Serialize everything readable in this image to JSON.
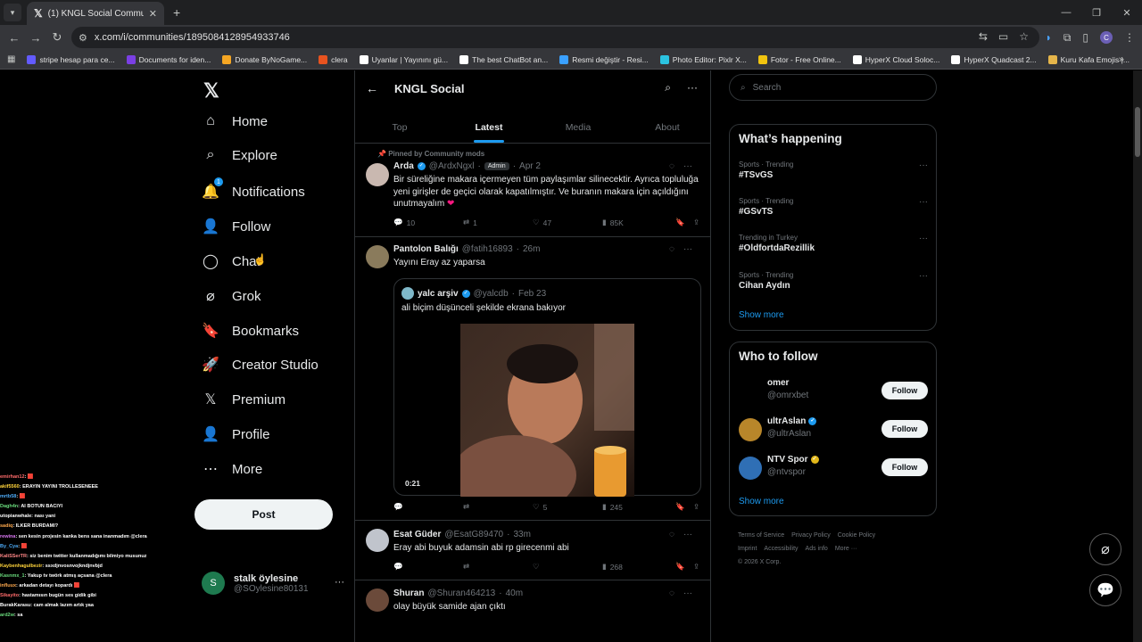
{
  "browser": {
    "tab_title": "(1) KNGL Social Community / X",
    "url": "x.com/i/communities/1895084128954933746",
    "bookmarks": [
      {
        "label": "stripe hesap para ce...",
        "color": "#635bff"
      },
      {
        "label": "Documents for iden...",
        "color": "#7b3fe4"
      },
      {
        "label": "Donate ByNoGame...",
        "color": "#f5a623"
      },
      {
        "label": "clera",
        "color": "#e8531f"
      },
      {
        "label": "Uyanlar | Yayınını gü...",
        "color": "#ffffff"
      },
      {
        "label": "The best ChatBot an...",
        "color": "#ffffff"
      },
      {
        "label": "Resmi değiştir - Resi...",
        "color": "#3aa0ff"
      },
      {
        "label": "Photo Editor: Pixlr X...",
        "color": "#2bc3e0"
      },
      {
        "label": "Fotor - Free Online...",
        "color": "#f1c40f"
      },
      {
        "label": "HyperX Cloud Soloc...",
        "color": "#ffffff"
      },
      {
        "label": "HyperX Quadcast 2...",
        "color": "#ffffff"
      },
      {
        "label": "Kuru Kafa Emojis |...",
        "color": "#e5b54a"
      }
    ]
  },
  "nav": {
    "items": [
      {
        "label": "Home",
        "icon": "home-icon"
      },
      {
        "label": "Explore",
        "icon": "search-icon"
      },
      {
        "label": "Notifications",
        "icon": "bell-icon",
        "badge": "1"
      },
      {
        "label": "Follow",
        "icon": "follow-icon"
      },
      {
        "label": "Chat",
        "icon": "chat-icon"
      },
      {
        "label": "Grok",
        "icon": "grok-icon"
      },
      {
        "label": "Bookmarks",
        "icon": "bookmark-icon"
      },
      {
        "label": "Creator Studio",
        "icon": "rocket-icon"
      },
      {
        "label": "Premium",
        "icon": "x-icon"
      },
      {
        "label": "Profile",
        "icon": "person-icon"
      },
      {
        "label": "More",
        "icon": "more-icon"
      }
    ],
    "post_label": "Post",
    "account": {
      "name": "stalk öylesine",
      "handle": "@SOylesine80131",
      "initial": "S"
    }
  },
  "chat_overlay": [
    {
      "user": "emirhan12",
      "msg": ": 🟥"
    },
    {
      "user": "akif5560",
      "msg": ": ERAYIN YAYINI TROLLESENEEE"
    },
    {
      "user": "mrtb58",
      "msg": ": 🟥"
    },
    {
      "user": "Dagh4n",
      "msg": ": AI BOTUN BACIYI"
    },
    {
      "user": "utopianwhale",
      "msg": ": nası yani"
    },
    {
      "user": "sadiq",
      "msg": ": ILKER BURDAMI?"
    },
    {
      "user": "rewina",
      "msg": ": sen kesin projesin kanka bens sana inanmadım @clera"
    },
    {
      "user": "By_Cya",
      "msg": ": 🟥"
    },
    {
      "user": "KaliSSerTR",
      "msg": ": siz benim twitter kullanmadığımı bilmiyo musunuz"
    },
    {
      "user": "Kaybenhagulbezir",
      "msg": ": ssxdjnvosnvojkndjnvbjd"
    },
    {
      "user": "Kasnmx_1",
      "msg": ": Yakup tv twörk atmış açsana @clera"
    },
    {
      "user": "influux",
      "msg": ": arkadan detayı kopardı 🟥"
    },
    {
      "user": "Sikayito",
      "msg": ": hastamısın bugün ses gidik gibi"
    },
    {
      "user": "BurakKarasu",
      "msg": ": cam almak lazım artık yaa"
    },
    {
      "user": "ard2w",
      "msg": ": sa"
    }
  ],
  "community": {
    "title": "KNGL Social",
    "tabs": [
      "Top",
      "Latest",
      "Media",
      "About"
    ],
    "active_tab": "Latest"
  },
  "tweets": [
    {
      "pinned_label": "Pinned by Community mods",
      "name": "Arda",
      "handle": "@ArdxNgxl",
      "role": "Admin",
      "time": "Apr 2",
      "text": "Bir süreliğine makara içermeyen tüm paylaşımlar silinecektir. Ayrıca topluluğa yeni girişler de geçici olarak kapatılmıştır. Ve buranın makara için açıldığını unutmayalım ❤️",
      "replies": "10",
      "reposts": "1",
      "likes": "47",
      "views": "85K"
    },
    {
      "name": "Pantolon Balığı",
      "handle": "@fatih16893",
      "time": "26m",
      "text": "Yayını Eray az yaparsa",
      "quote": {
        "name": "yalc arşiv",
        "handle": "@yalcdb",
        "time": "Feb 23",
        "text": "ali biçim düşünceli şekilde ekrana bakıyor",
        "duration": "0:21"
      },
      "replies": "",
      "reposts": "",
      "likes": "5",
      "views": "245"
    },
    {
      "name": "Esat Güder",
      "handle": "@EsatG89470",
      "time": "33m",
      "text": "Eray abi buyuk adamsin abi rp girecenmi abi",
      "replies": "",
      "reposts": "",
      "likes": "",
      "views": "268"
    },
    {
      "name": "Shuran",
      "handle": "@Shuran464213",
      "time": "40m",
      "text": "olay büyük samide ajan çıktı"
    }
  ],
  "sidebar": {
    "search_placeholder": "Search",
    "whats_happening": "What’s happening",
    "trends": [
      {
        "context": "Sports · Trending",
        "name": "#TSvGS"
      },
      {
        "context": "Sports · Trending",
        "name": "#GSvTS"
      },
      {
        "context": "Trending in Turkey",
        "name": "#OldfortdaRezillik"
      },
      {
        "context": "Sports · Trending",
        "name": "Cihan Aydın"
      }
    ],
    "show_more": "Show more",
    "who_to_follow": "Who to follow",
    "follow_suggestions": [
      {
        "name": "omer",
        "handle": "@omrxbet",
        "verified": ""
      },
      {
        "name": "ultrAslan",
        "handle": "@ultrAslan",
        "verified": "blue"
      },
      {
        "name": "NTV Spor",
        "handle": "@ntvspor",
        "verified": "gold"
      }
    ],
    "follow_label": "Follow",
    "footer": [
      "Terms of Service",
      "Privacy Policy",
      "Cookie Policy",
      "Imprint",
      "Accessibility",
      "Ads info",
      "More ···",
      "© 2026 X Corp."
    ]
  }
}
